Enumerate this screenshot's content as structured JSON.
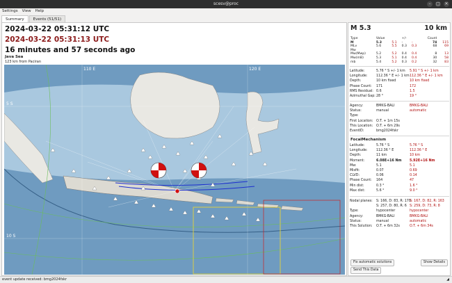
{
  "window": {
    "title": "scesv@proc",
    "controls": [
      "–",
      "□",
      "✕"
    ]
  },
  "menu": [
    "Settings",
    "View",
    "Help"
  ],
  "tabs": [
    "Summary",
    "Events (51/51)"
  ],
  "summary": {
    "origin_time": "2024-03-22 05:31:12 UTC",
    "alt_time": "2024-03-22 05:31:13 UTC",
    "elapsed": "16 minutes and 57 seconds ago",
    "region": "Java Sea",
    "distance": "123 km from Paciran"
  },
  "map": {
    "lat_labels": [
      "5 S",
      "10 S"
    ],
    "lon_labels": [
      "110 E",
      "120 E"
    ]
  },
  "details": {
    "magnitude": "M 5.3",
    "depth": "10 km",
    "mag_headers": [
      "Type",
      "Value",
      "+/-",
      "",
      "Count"
    ],
    "mag_rows": [
      {
        "type": "M",
        "v1": "5.3",
        "v2": "5.1",
        "e1": "-",
        "e2": "-",
        "c1": "74",
        "c2": "115",
        "bold": true
      },
      {
        "type": "MLv",
        "v1": "5.6",
        "v2": "5.5",
        "e1": "0.3",
        "e2": "0.3",
        "c1": "68",
        "c2": "69"
      },
      {
        "type": "Mw",
        "v1": "",
        "v2": "",
        "e1": "",
        "e2": "",
        "c1": "",
        "c2": ""
      },
      {
        "type": "Mw(Mwp)",
        "v1": "5.2",
        "v2": "5.2",
        "e1": "0.4",
        "e2": "0.4",
        "c1": "8",
        "c2": "13"
      },
      {
        "type": "Mw(mB)",
        "v1": "5.3",
        "v2": "5.1",
        "e1": "0.4",
        "e2": "0.4",
        "c1": "30",
        "c2": "58"
      },
      {
        "type": "mb",
        "v1": "5.4",
        "v2": "5.2",
        "e1": "0.3",
        "e2": "0.2",
        "c1": "32",
        "c2": "83"
      }
    ],
    "origin_rows": [
      {
        "k": "Latitude:",
        "v": "5.76 ° S  +/-  1 km",
        "e": "5.91 ° S  +/-  1 km"
      },
      {
        "k": "Longitude:",
        "v": "112.36 ° E  +/-  1 km",
        "e": "112.36 ° E  +/-  1 km"
      },
      {
        "k": "Depth:",
        "v": "10 km   fixed",
        "e": "10 km   fixed"
      },
      {
        "k": "Phase Count:",
        "v": "171",
        "e": "172"
      },
      {
        "k": "RMS Residual:",
        "v": "0.6",
        "e": "1.5"
      },
      {
        "k": "Azimuthal Gap:",
        "v": "28 °",
        "e": "19 °"
      }
    ],
    "agency_rows": [
      {
        "k": "Agency:",
        "v": "BMKG-BALI",
        "e": "BMKG-BALI"
      },
      {
        "k": "Status:",
        "v": "manual",
        "e": "automatic"
      },
      {
        "k": "Type:",
        "v": "",
        "e": ""
      },
      {
        "k": "First Location:",
        "v": "O.T. + 1m 15s",
        "e": ""
      },
      {
        "k": "This Location:",
        "v": "O.T. + 6m 29s",
        "e": ""
      },
      {
        "k": "EventID:",
        "v": "bmg2024fskr",
        "e": ""
      }
    ],
    "fm_title": "FocalMechanism",
    "fm_rows": [
      {
        "k": "Latitude:",
        "v": "5.76 ° S",
        "e": "5.76 ° S"
      },
      {
        "k": "Longitude:",
        "v": "112.36 ° E",
        "e": "112.36 ° E"
      },
      {
        "k": "Depth:",
        "v": "11 km",
        "e": "10 km"
      },
      {
        "k": "Moment:",
        "v": "6.08E+16 Nm",
        "e": "5.92E+16 Nm"
      },
      {
        "k": "Mw:",
        "v": "5.1",
        "e": "5.1"
      },
      {
        "k": "Misfit:",
        "v": "0.07",
        "e": "0.69"
      },
      {
        "k": "CLVD:",
        "v": "0.06",
        "e": "0.14"
      },
      {
        "k": "Phase Count:",
        "v": "164",
        "e": "47"
      },
      {
        "k": "Min dist:",
        "v": "0.3 °",
        "e": "1.6 °"
      },
      {
        "k": "Max dist:",
        "v": "5.6 °",
        "e": "9.0 °"
      }
    ],
    "np_rows": [
      {
        "k": "Nodal planes:",
        "v": "S: 166, D: 83, R: 170",
        "e": "S: 167, D: 82, R: 163"
      },
      {
        "k": "",
        "v": "S: 257, D: 80, R: 6",
        "e": "S: 259, D: 73, R: 8"
      },
      {
        "k": "Type:",
        "v": "hypocenter",
        "e": "hypocenter"
      },
      {
        "k": "Agency:",
        "v": "BMKG-BALI",
        "e": "BMKG-BALI"
      },
      {
        "k": "Status:",
        "v": "manual",
        "e": "automatic"
      },
      {
        "k": "This Solution:",
        "v": "O.T. + 6m 32s",
        "e": "O.T. + 6m 34s"
      }
    ],
    "buttons": {
      "fix": "Fix automatic solutions",
      "show": "Show Details",
      "send": "Send This Data"
    }
  },
  "status": {
    "text": "event update received: bmg2024fskr"
  },
  "colors": {
    "accent_red": "#b01010",
    "epicenter": "#d01010",
    "titlebar": "#2f2f2f"
  }
}
